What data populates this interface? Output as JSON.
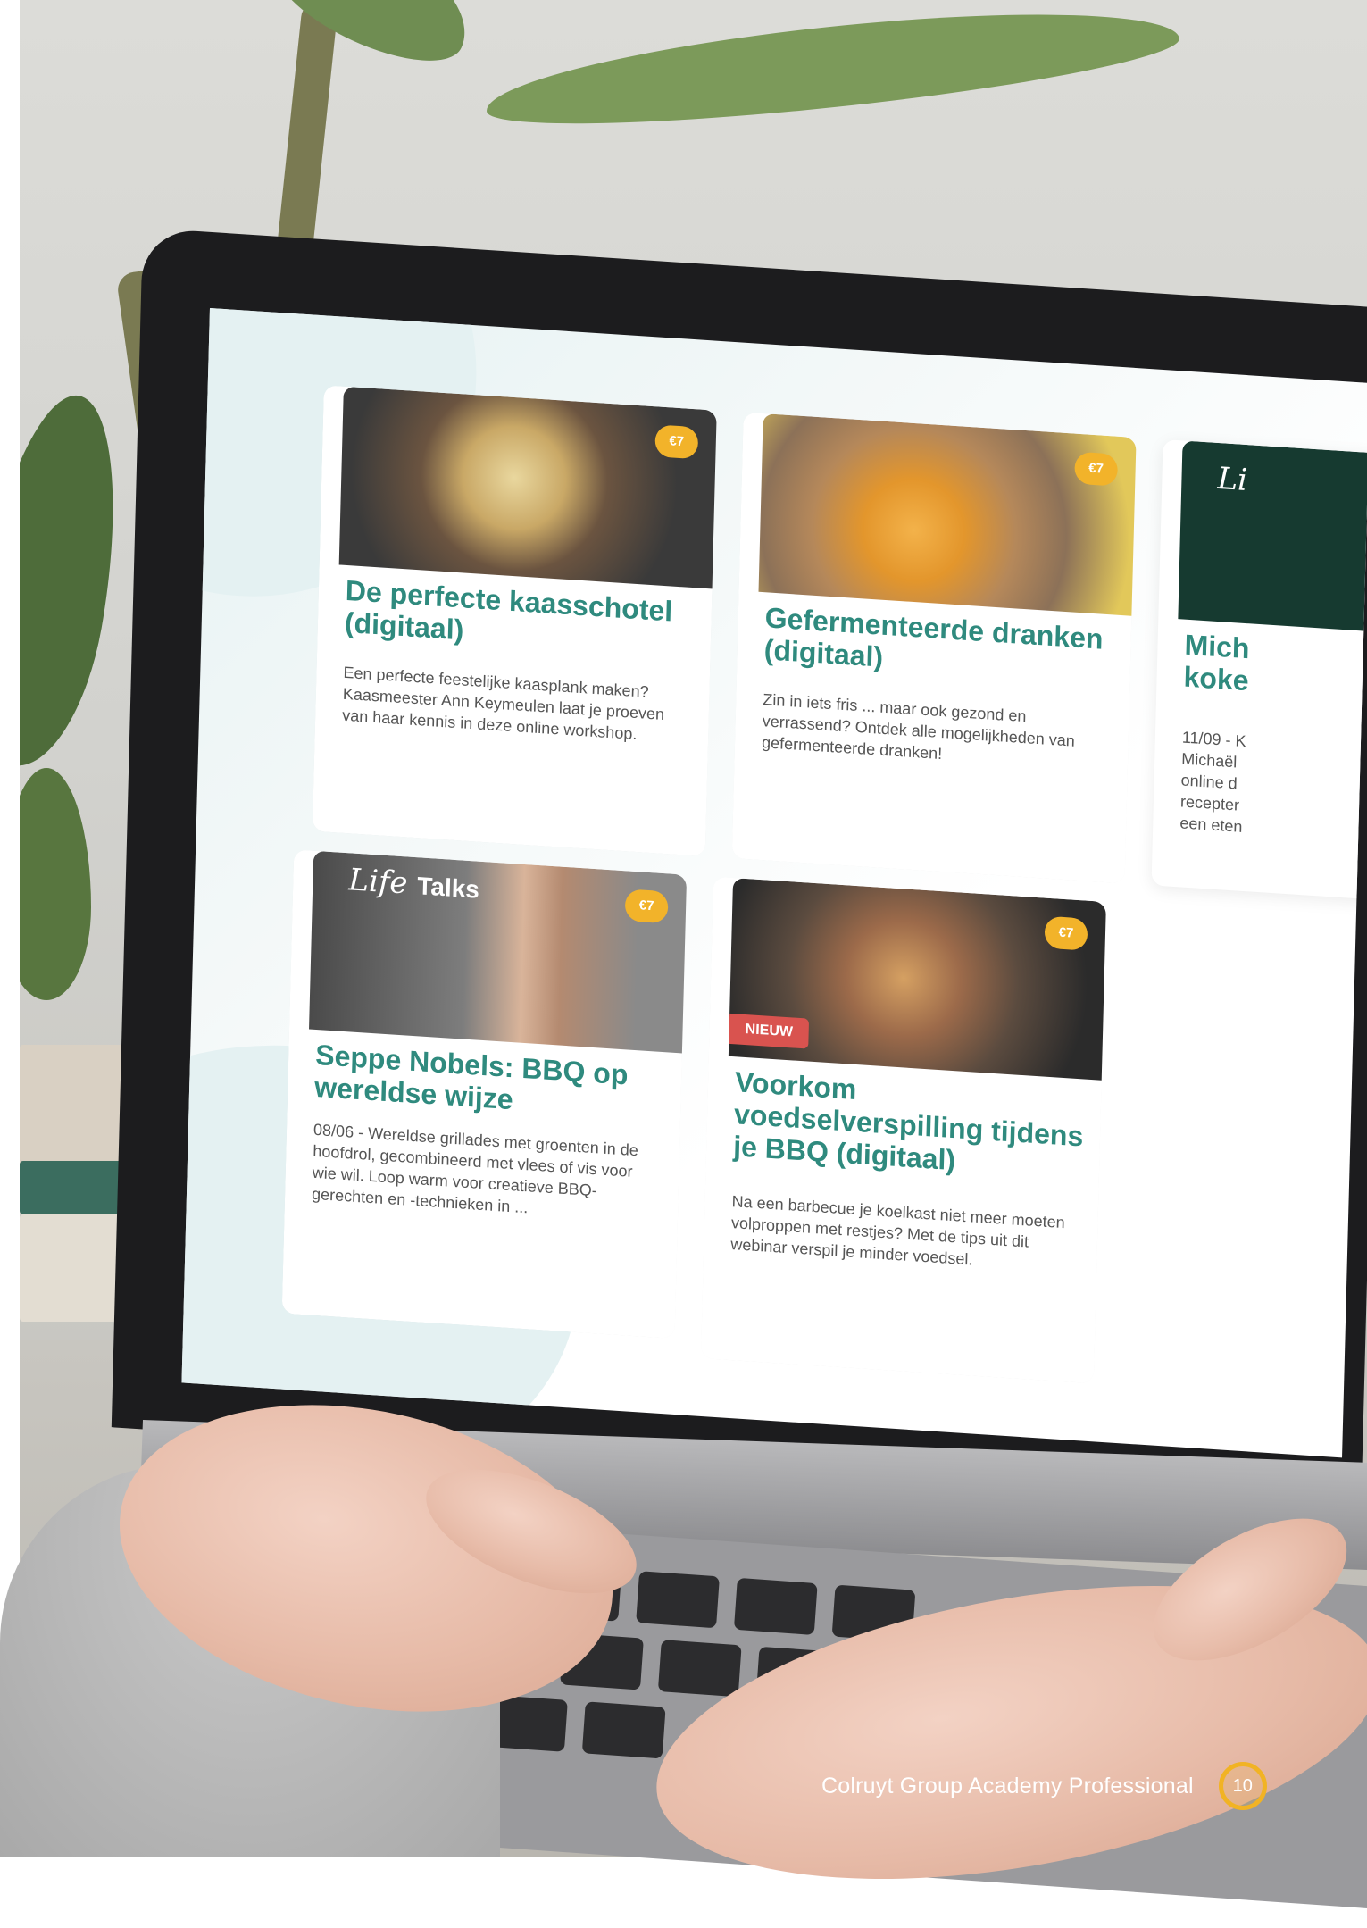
{
  "cards": [
    {
      "price": "€7",
      "title": "De perfecte kaasschotel (digitaal)",
      "description": "Een perfecte feestelijke kaasplank maken? Kaasmeester Ann Keymeulen laat je proeven van haar kennis in deze online workshop."
    },
    {
      "price": "€7",
      "title": "Gefermenteerde dranken (digitaal)",
      "description": "Zin in iets fris ... maar ook gezond en verrassend? Ontdek alle mogelijkheden van gefermenteerde dranken!"
    },
    {
      "title": "Mich koke",
      "description": "11/09 - K Michaël online d recepter een eten"
    },
    {
      "price": "€7",
      "logo": "Life",
      "logo_suffix": "Talks",
      "title": "Seppe Nobels: BBQ op wereldse wijze",
      "description": "08/06 - Wereldse grillades met groenten in de hoofdrol, gecombineerd met vlees of vis voor wie wil. Loop warm voor creatieve BBQ-gerechten en -technieken in ..."
    },
    {
      "price": "€7",
      "badge": "NIEUW",
      "title": "Voorkom voedselverspilling tijdens je BBQ (digitaal)",
      "description": "Na een barbecue je koelkast niet meer moeten volproppen met restjes? Met de tips uit dit webinar verspil je minder voedsel."
    }
  ],
  "partial_card_logo": "Li",
  "footer": {
    "text": "Colruyt Group Academy Professional",
    "page_number": "10"
  },
  "colors": {
    "title_teal": "#2f8a7e",
    "price_badge": "#f2b32a",
    "new_badge": "#d9534f",
    "page_ring": "#f1b324"
  }
}
